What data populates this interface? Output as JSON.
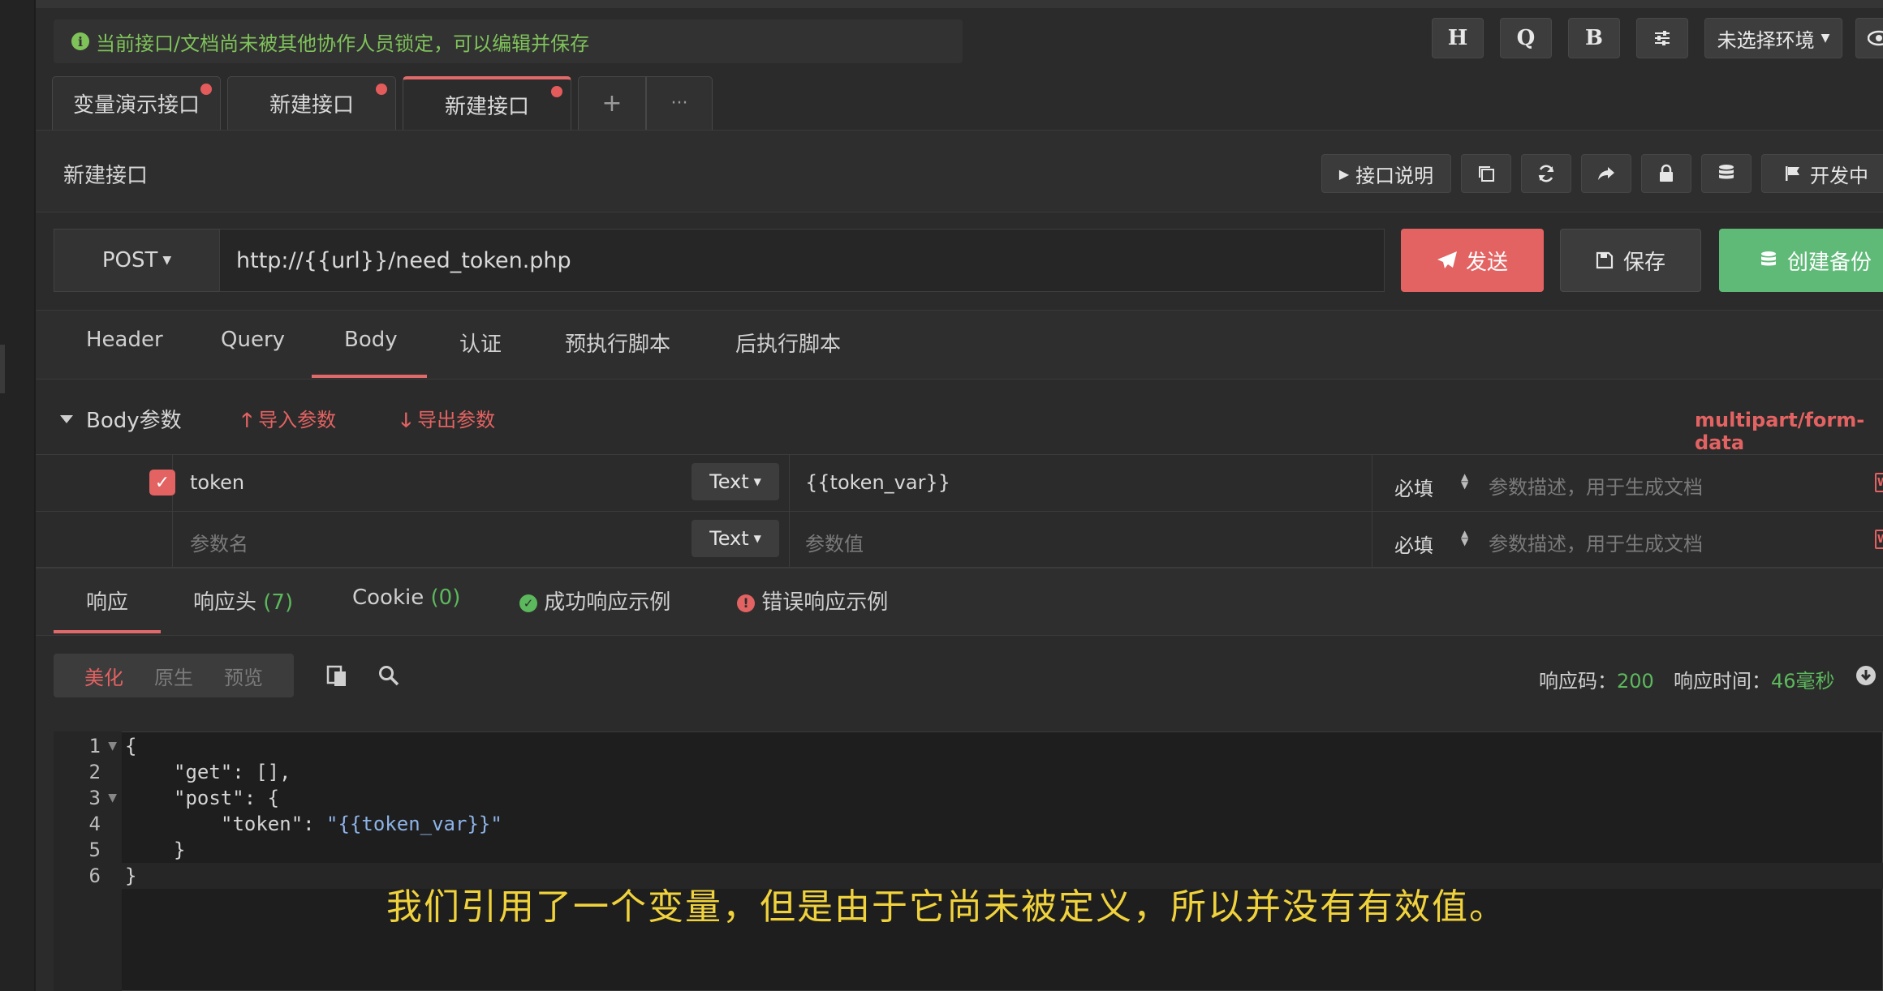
{
  "lock_notice": "当前接口/文档尚未被其他协作人员锁定，可以编辑并保存",
  "top_buttons": [
    "H",
    "Q",
    "B"
  ],
  "env_label": "未选择环境",
  "tabs": [
    {
      "label": "变量演示接口"
    },
    {
      "label": "新建接口"
    },
    {
      "label": "新建接口"
    }
  ],
  "tab_add": "+",
  "tab_more": "···",
  "page_title": "新建接口",
  "toolbar": {
    "doc": "接口说明",
    "status": "开发中"
  },
  "request": {
    "method": "POST",
    "url": "http://{{url}}/need_token.php",
    "send": "发送",
    "save": "保存",
    "backup": "创建备份"
  },
  "request_tabs": [
    "Header",
    "Query",
    "Body",
    "认证",
    "预执行脚本",
    "后执行脚本"
  ],
  "body": {
    "title": "Body参数",
    "import": "导入参数",
    "export": "导出参数",
    "content_type": "multipart/form-data",
    "rows": [
      {
        "name": "token",
        "type": "Text",
        "value": "{{token_var}}",
        "required": "必填",
        "desc_placeholder": "参数描述，用于生成文档"
      },
      {
        "name_placeholder": "参数名",
        "type": "Text",
        "value_placeholder": "参数值",
        "required": "必填",
        "desc_placeholder": "参数描述，用于生成文档"
      }
    ]
  },
  "response_tabs": {
    "resp": "响应",
    "headers": "响应头",
    "headers_count": "(7)",
    "cookie": "Cookie",
    "cookie_count": "(0)",
    "success": "成功响应示例",
    "error": "错误响应示例"
  },
  "view_modes": [
    "美化",
    "原生",
    "预览"
  ],
  "status_label": "响应码：",
  "status_code": "200",
  "time_label": "响应时间：",
  "time_value": "46毫秒",
  "code": {
    "line_numbers": [
      "1",
      "2",
      "3",
      "4",
      "5",
      "6"
    ],
    "l1": "{",
    "l2": "\"get\": [],",
    "l3": "\"post\": {",
    "l4_key": "\"token\": ",
    "l4_val": "\"{{token_var}}\"",
    "l5": "}",
    "l6": "}"
  },
  "subtitle": "我们引用了一个变量，但是由于它尚未被定义，所以并没有有效值。",
  "colors": {
    "accent": "#e36262",
    "success": "#5cb85c",
    "notice": "#7fc25a",
    "subtitle": "#f0d23c"
  }
}
